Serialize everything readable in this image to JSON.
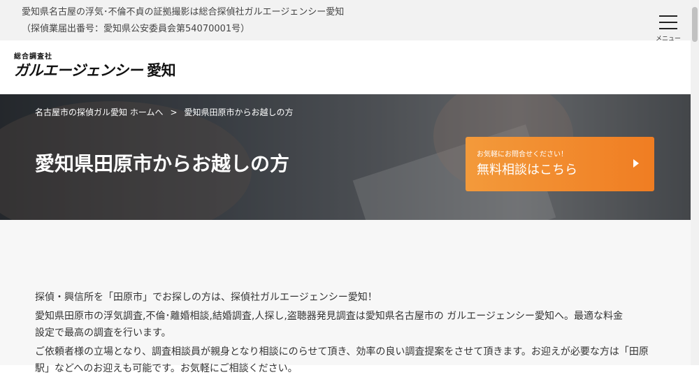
{
  "topbar": {
    "line1": "愛知県名古屋の浮気･不倫不貞の証拠撮影は総合探偵社ガルエージェンシー愛知",
    "line2": "（探偵業届出番号：愛知県公安委員会第54070001号）",
    "menu_label": "メニュー"
  },
  "logo": {
    "small": "総合調査社",
    "brand": "ガルエージェンシー",
    "region": "愛知"
  },
  "breadcrumb": {
    "home": "名古屋市の探偵ガル愛知 ホームへ",
    "separator": ">",
    "current": "愛知県田原市からお越しの方"
  },
  "hero": {
    "title": "愛知県田原市からお越しの方"
  },
  "cta": {
    "sub": "お気軽にお問合せください！",
    "main": "無料相談はこちら"
  },
  "content": {
    "p1": "探偵・興信所を「田原市」でお探しの方は、探偵社ガルエージェンシー愛知！",
    "p2": "愛知県田原市の浮気調査,不倫･離婚相談,結婚調査,人探し,盗聴器発見調査は愛知県名古屋市の ガルエージェンシー愛知へ。最適な料金",
    "p3": "設定で最高の調査を行います。",
    "p4": "ご依頼者様の立場となり、調査相談員が親身となり相談にのらせて頂き、効率の良い調査提案をさせて頂きます。お迎えが必要な方は「田原",
    "p5": "駅」などへのお迎えも可能です。お気軽にご相談ください。"
  },
  "colors": {
    "cta_start": "#f39a3b",
    "cta_end": "#f07d22",
    "topbar_bg": "#f2f2f2",
    "content_bg": "#f7f7f7"
  },
  "icons": {
    "menu": "hamburger-menu-icon",
    "cta_arrow": "triangle-right-icon"
  }
}
